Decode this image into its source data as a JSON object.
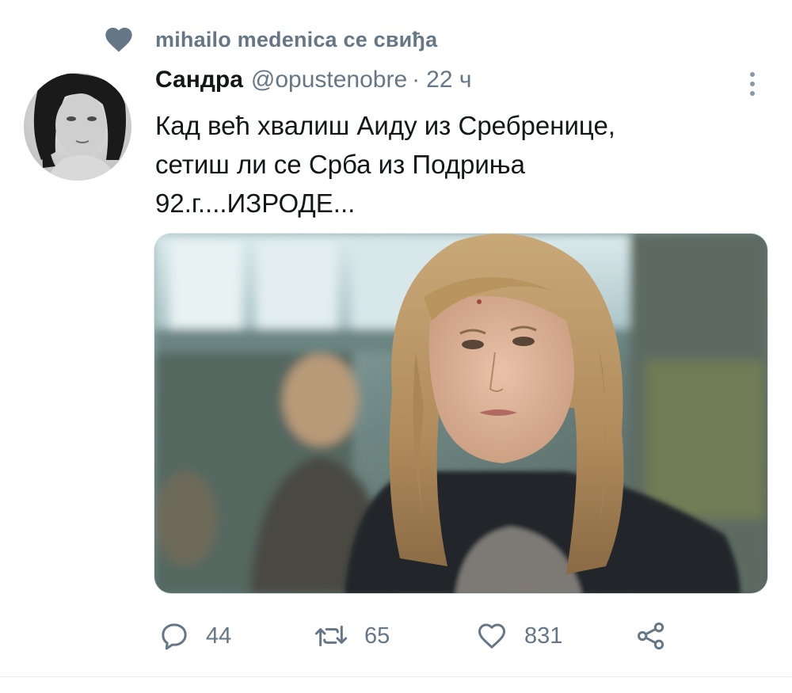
{
  "social_context": {
    "icon": "heart-icon",
    "text": "mihailo medenica се свиђа"
  },
  "tweet": {
    "author_name": "Сандра",
    "author_handle": "@opustenobre",
    "separator": "·",
    "timestamp": "22 ч",
    "text_lines": [
      "Кад већ хвалиш Аиду из Сребренице,",
      "сетиш ли се Срба из Подриња",
      "92.г....ИЗРОДЕ..."
    ],
    "media_icon": "photo-blonde-woman-in-dark-jacket"
  },
  "actions": {
    "reply": {
      "icon": "reply-icon",
      "count": "44"
    },
    "retweet": {
      "icon": "retweet-icon",
      "count": "65"
    },
    "like": {
      "icon": "heart-outline-icon",
      "count": "831"
    },
    "share": {
      "icon": "share-icon"
    }
  },
  "colors": {
    "secondary_text": "#657786",
    "primary_text": "#14171a",
    "icon_gray": "#657786"
  }
}
